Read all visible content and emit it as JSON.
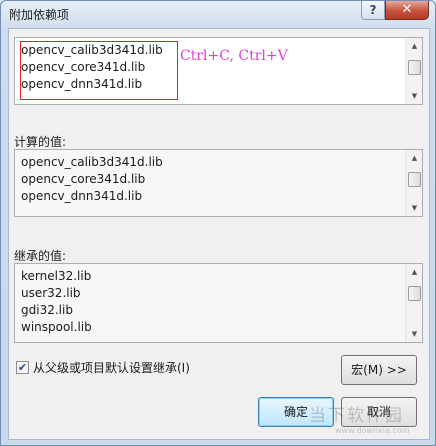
{
  "window": {
    "title": "附加依赖项",
    "help_button": "?",
    "close_button": "✕"
  },
  "top_list": {
    "items": [
      "opencv_calib3d341d.lib",
      "opencv_core341d.lib",
      "opencv_dnn341d.lib"
    ],
    "annotation": "Ctrl+C, Ctrl+V"
  },
  "computed": {
    "label": "计算的值:",
    "items": [
      "opencv_calib3d341d.lib",
      "opencv_core341d.lib",
      "opencv_dnn341d.lib"
    ]
  },
  "inherited": {
    "label": "继承的值:",
    "items": [
      "kernel32.lib",
      "user32.lib",
      "gdi32.lib",
      "winspool.lib"
    ]
  },
  "inherit_checkbox": {
    "label": "从父级或项目默认设置继承(I)",
    "checked": true
  },
  "buttons": {
    "macro": "宏(M) >>",
    "ok": "确定",
    "cancel": "取消"
  },
  "watermark": {
    "line1": "当下软件园",
    "line2": "www.downxia.com"
  }
}
